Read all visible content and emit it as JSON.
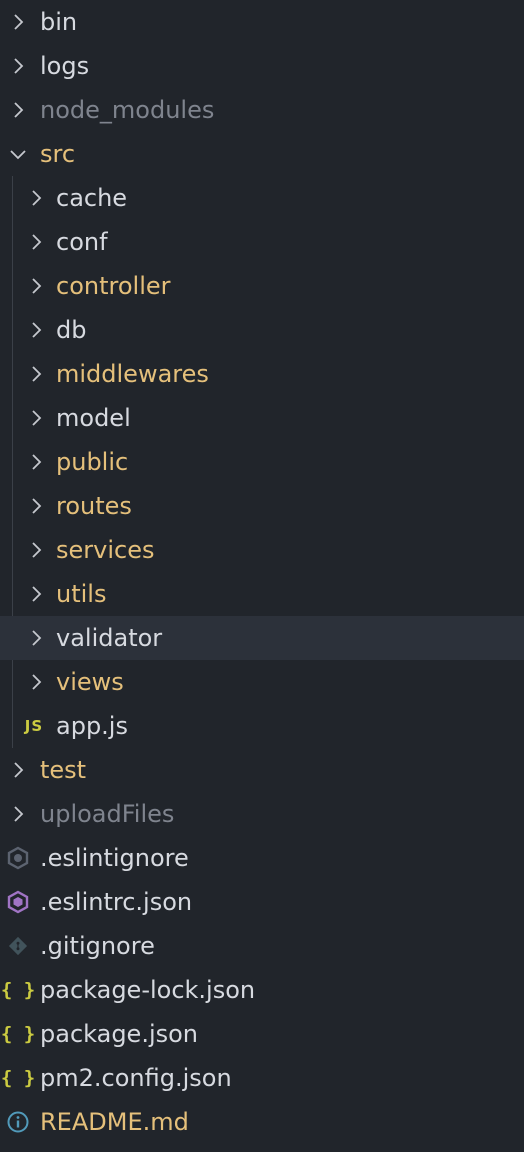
{
  "explorer": {
    "items": [
      {
        "label": "bin",
        "kind": "folder",
        "level": 0,
        "expanded": false,
        "color": "#d7dae0"
      },
      {
        "label": "logs",
        "kind": "folder",
        "level": 0,
        "expanded": false,
        "color": "#d7dae0"
      },
      {
        "label": "node_modules",
        "kind": "folder",
        "level": 0,
        "expanded": false,
        "color": "#7f848e"
      },
      {
        "label": "src",
        "kind": "folder",
        "level": 0,
        "expanded": true,
        "color": "#e5c07b"
      },
      {
        "label": "cache",
        "kind": "folder",
        "level": 1,
        "expanded": false,
        "color": "#d7dae0"
      },
      {
        "label": "conf",
        "kind": "folder",
        "level": 1,
        "expanded": false,
        "color": "#d7dae0"
      },
      {
        "label": "controller",
        "kind": "folder",
        "level": 1,
        "expanded": false,
        "color": "#e5c07b"
      },
      {
        "label": "db",
        "kind": "folder",
        "level": 1,
        "expanded": false,
        "color": "#d7dae0"
      },
      {
        "label": "middlewares",
        "kind": "folder",
        "level": 1,
        "expanded": false,
        "color": "#e5c07b"
      },
      {
        "label": "model",
        "kind": "folder",
        "level": 1,
        "expanded": false,
        "color": "#d7dae0"
      },
      {
        "label": "public",
        "kind": "folder",
        "level": 1,
        "expanded": false,
        "color": "#e5c07b"
      },
      {
        "label": "routes",
        "kind": "folder",
        "level": 1,
        "expanded": false,
        "color": "#e5c07b"
      },
      {
        "label": "services",
        "kind": "folder",
        "level": 1,
        "expanded": false,
        "color": "#e5c07b"
      },
      {
        "label": "utils",
        "kind": "folder",
        "level": 1,
        "expanded": false,
        "color": "#e5c07b"
      },
      {
        "label": "validator",
        "kind": "folder",
        "level": 1,
        "expanded": false,
        "color": "#d7dae0",
        "selected": true
      },
      {
        "label": "views",
        "kind": "folder",
        "level": 1,
        "expanded": false,
        "color": "#e5c07b"
      },
      {
        "label": "app.js",
        "kind": "file",
        "level": 1,
        "icon": "javascript-icon",
        "icon_text": "JS",
        "color": "#d7dae0"
      },
      {
        "label": "test",
        "kind": "folder",
        "level": 0,
        "expanded": false,
        "color": "#e5c07b"
      },
      {
        "label": "uploadFiles",
        "kind": "folder",
        "level": 0,
        "expanded": false,
        "color": "#7f848e"
      },
      {
        "label": ".eslintignore",
        "kind": "file",
        "level": 0,
        "icon": "eslint-ignore-icon",
        "color": "#d7dae0"
      },
      {
        "label": ".eslintrc.json",
        "kind": "file",
        "level": 0,
        "icon": "eslint-icon",
        "color": "#d7dae0"
      },
      {
        "label": ".gitignore",
        "kind": "file",
        "level": 0,
        "icon": "git-icon",
        "color": "#d7dae0"
      },
      {
        "label": "package-lock.json",
        "kind": "file",
        "level": 0,
        "icon": "json-icon",
        "icon_text": "{ }",
        "color": "#d7dae0"
      },
      {
        "label": "package.json",
        "kind": "file",
        "level": 0,
        "icon": "json-icon",
        "icon_text": "{ }",
        "color": "#d7dae0"
      },
      {
        "label": "pm2.config.json",
        "kind": "file",
        "level": 0,
        "icon": "json-icon",
        "icon_text": "{ }",
        "color": "#d7dae0"
      },
      {
        "label": "README.md",
        "kind": "file",
        "level": 0,
        "icon": "info-icon",
        "color": "#e5c07b"
      }
    ]
  },
  "colors": {
    "background": "#21252b",
    "selection": "#2c313a",
    "modified_yellow": "#e5c07b",
    "ignored_gray": "#7f848e",
    "json_icon": "#cbcb41",
    "eslint_purple": "#a074c4",
    "info_blue": "#519aba"
  }
}
